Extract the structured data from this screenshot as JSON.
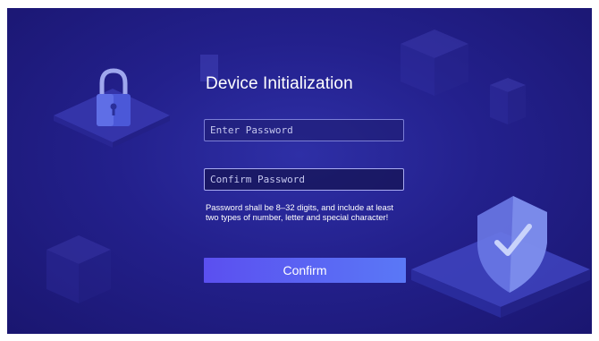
{
  "form": {
    "title": "Device Initialization",
    "password_placeholder": "Enter Password",
    "confirm_placeholder": "Confirm Password",
    "hint": "Password shall be 8–32 digits, and include at least two types of number, letter and special character!",
    "confirm_label": "Confirm"
  },
  "colors": {
    "background": "#23208c",
    "button_start": "#5b4ff0",
    "button_end": "#5a78f6"
  },
  "icons": {
    "left_decoration": "padlock-icon",
    "right_decoration": "shield-check-icon"
  }
}
